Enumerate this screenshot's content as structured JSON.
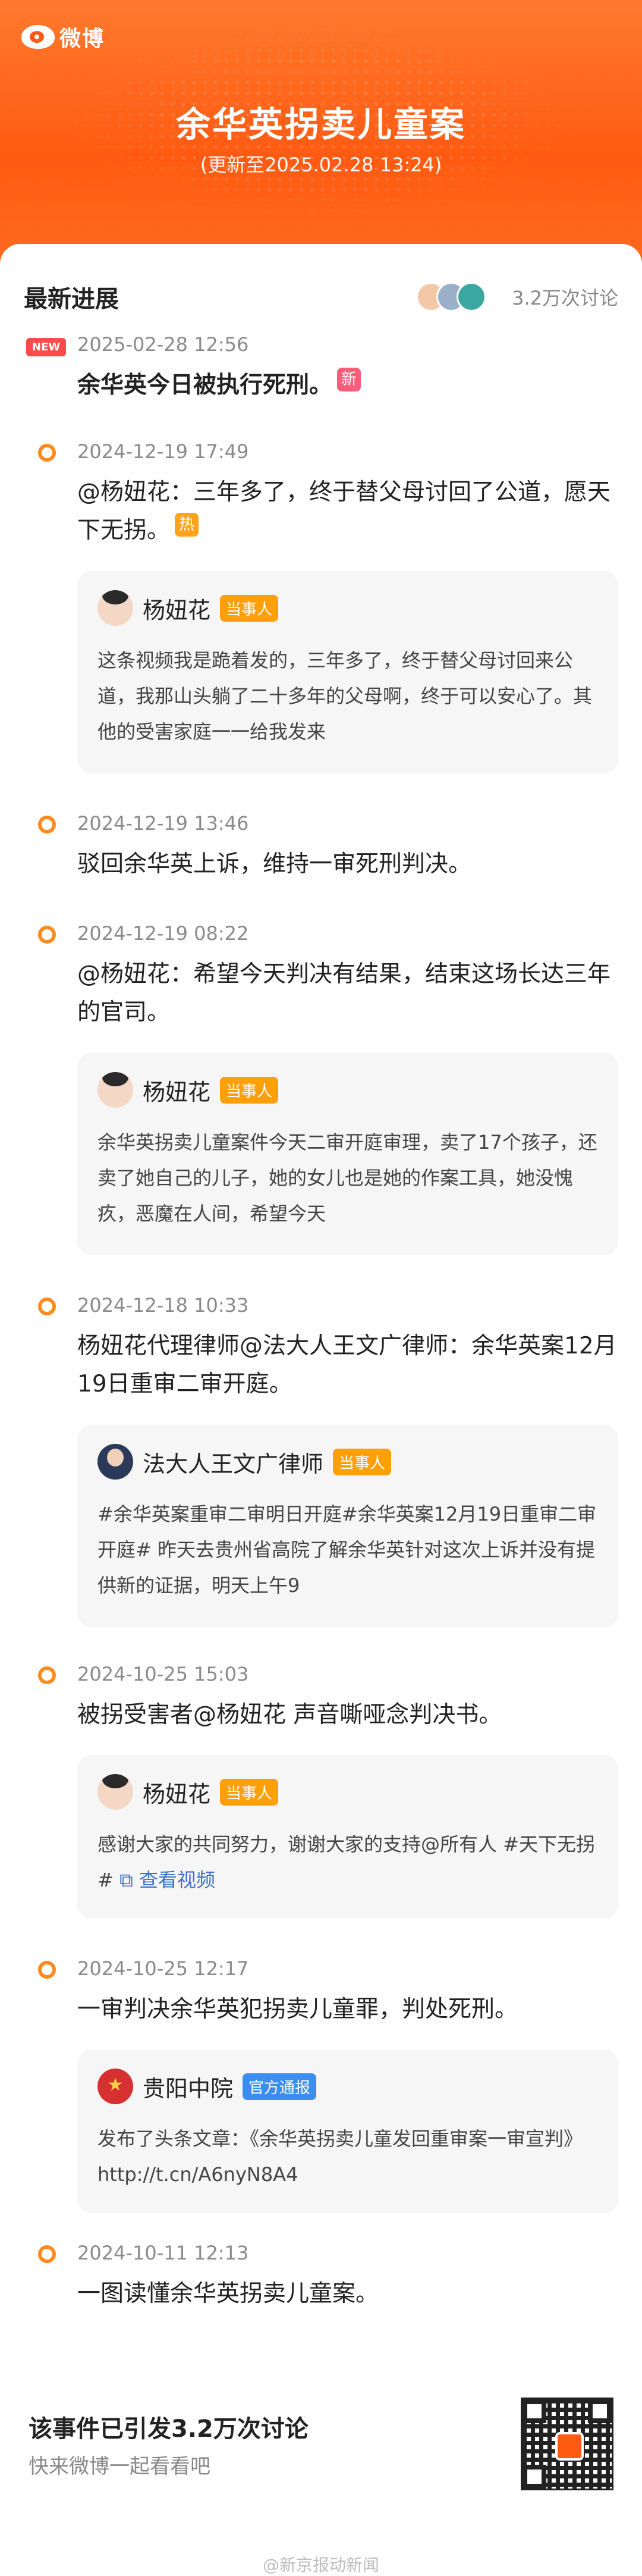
{
  "header": {
    "logo_text": "微博",
    "title": "余华英拐卖儿童案",
    "subtitle": "(更新至2025.02.28 13:24)"
  },
  "card": {
    "heading": "最新进展",
    "discussion_count": "3.2万次讨论",
    "new_badge": "NEW"
  },
  "timeline": [
    {
      "time": "2025-02-28 12:56",
      "text": "余华英今日被执行死刑。",
      "tag": "新"
    },
    {
      "time": "2024-12-19 17:49",
      "text": "@杨妞花：三年多了，终于替父母讨回了公道，愿天下无拐。",
      "tag": "热",
      "quote": {
        "name": "杨妞花",
        "badge": "当事人",
        "text": "这条视频我是跪着发的，三年多了，终于替父母讨回来公道，我那山头躺了二十多年的父母啊，终于可以安心了。其他的受害家庭一一给我发来"
      }
    },
    {
      "time": "2024-12-19 13:46",
      "text": "驳回余华英上诉，维持一审死刑判决。"
    },
    {
      "time": "2024-12-19 08:22",
      "text": "@杨妞花：希望今天判决有结果，结束这场长达三年的官司。",
      "quote": {
        "name": "杨妞花",
        "badge": "当事人",
        "text": "余华英拐卖儿童案件今天二审开庭审理，卖了17个孩子，还卖了她自己的儿子，她的女儿也是她的作案工具，她没愧疚，恶魔在人间，希望今天"
      }
    },
    {
      "time": "2024-12-18 10:33",
      "text": "杨妞花代理律师@法大人王文广律师：余华英案12月19日重审二审开庭。",
      "quote": {
        "name": "法大人王文广律师",
        "badge": "当事人",
        "text": "#余华英案重审二审明日开庭#余华英案12月19日重审二审开庭# 昨天去贵州省高院了解余华英针对这次上诉并没有提供新的证据，明天上午9"
      }
    },
    {
      "time": "2024-10-25 15:03",
      "text": "被拐受害者@杨妞花 声音嘶哑念判决书。",
      "quote": {
        "name": "杨妞花",
        "badge": "当事人",
        "text": "感谢大家的共同努力，谢谢大家的支持@所有人 #天下无拐#",
        "link": "查看视频"
      }
    },
    {
      "time": "2024-10-25 12:17",
      "text": "一审判决余华英犯拐卖儿童罪，判处死刑。",
      "quote": {
        "name": "贵阳中院",
        "badge": "官方通报",
        "text": "发布了头条文章：《余华英拐卖儿童发回重审案一审宣判》 http://t.cn/A6nyN8A4"
      }
    },
    {
      "time": "2024-10-11 12:13",
      "text": "一图读懂余华英拐卖儿童案。"
    }
  ],
  "footer": {
    "title": "该事件已引发3.2万次讨论",
    "subtitle": "快来微博一起看看吧",
    "watermark": "@新京报动新闻"
  },
  "colors": {
    "brand_orange": "#ff5a12",
    "dot_orange": "#ff8a20",
    "party_badge": "#ff9f0a",
    "official_badge": "#3b8ef0"
  }
}
